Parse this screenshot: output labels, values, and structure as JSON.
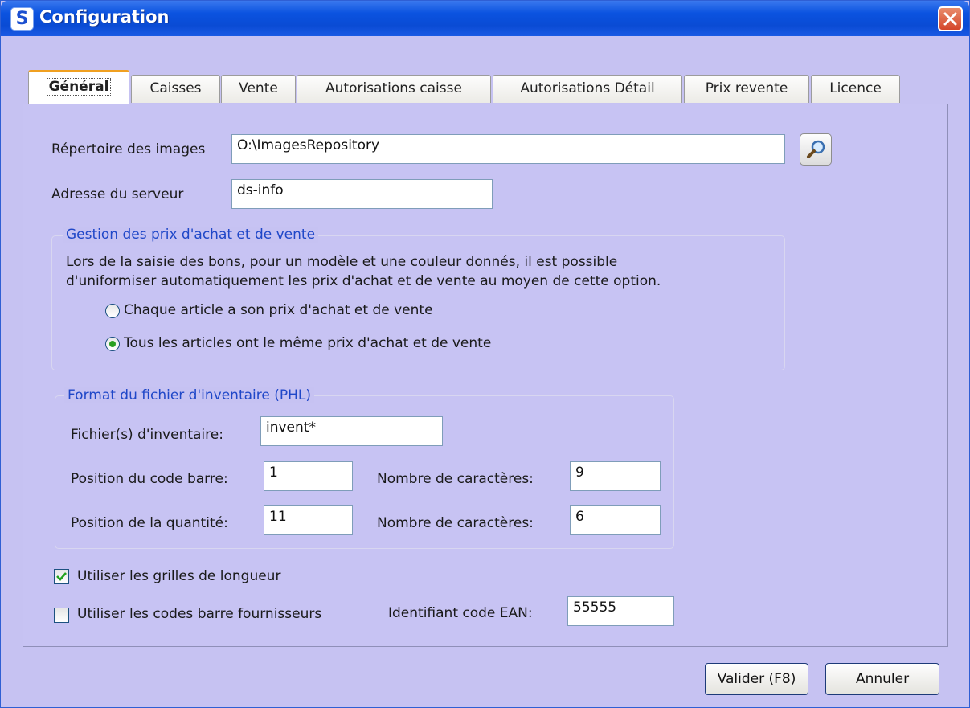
{
  "window": {
    "title": "Configuration",
    "app_icon_letter": "S"
  },
  "tabs": [
    {
      "label": "Général",
      "active": true
    },
    {
      "label": "Caisses",
      "active": false
    },
    {
      "label": "Vente",
      "active": false
    },
    {
      "label": "Autorisations caisse",
      "active": false
    },
    {
      "label": "Autorisations Détail",
      "active": false
    },
    {
      "label": "Prix revente",
      "active": false
    },
    {
      "label": "Licence",
      "active": false
    }
  ],
  "general": {
    "images_dir_label": "Répertoire des images",
    "images_dir_value": "O:\\ImagesRepository",
    "server_label": "Adresse du serveur",
    "server_value": "ds-info",
    "pricing_group": {
      "title": "Gestion des prix d'achat et de vente",
      "desc_line1": "Lors de la saisie des bons, pour un modèle et une couleur donnés, il est possible",
      "desc_line2": "d'uniformiser automatiquement les prix d'achat et de vente au moyen de cette option.",
      "option1": "Chaque article a son prix d'achat et de vente",
      "option2": "Tous les articles ont le même prix d'achat et de vente",
      "selected": 2
    },
    "inventory_group": {
      "title": "Format du fichier d'inventaire (PHL)",
      "files_label": "Fichier(s) d'inventaire:",
      "files_value": "invent*",
      "barcode_pos_label": "Position du code barre:",
      "barcode_pos_value": "1",
      "barcode_len_label": "Nombre de caractères:",
      "barcode_len_value": "9",
      "qty_pos_label": "Position de la quantité:",
      "qty_pos_value": "11",
      "qty_len_label": "Nombre de caractères:",
      "qty_len_value": "6"
    },
    "use_length_grids_label": "Utiliser les grilles de longueur",
    "use_length_grids_checked": true,
    "use_supplier_barcodes_label": "Utiliser les codes barre fournisseurs",
    "use_supplier_barcodes_checked": false,
    "ean_label": "Identifiant code EAN:",
    "ean_value": "55555"
  },
  "buttons": {
    "validate": "Valider (F8)",
    "cancel": "Annuler"
  },
  "colors": {
    "titlebar": "#0b53e0",
    "background": "#c6c2f2",
    "group_title": "#1f47c8",
    "close": "#d4462a"
  }
}
